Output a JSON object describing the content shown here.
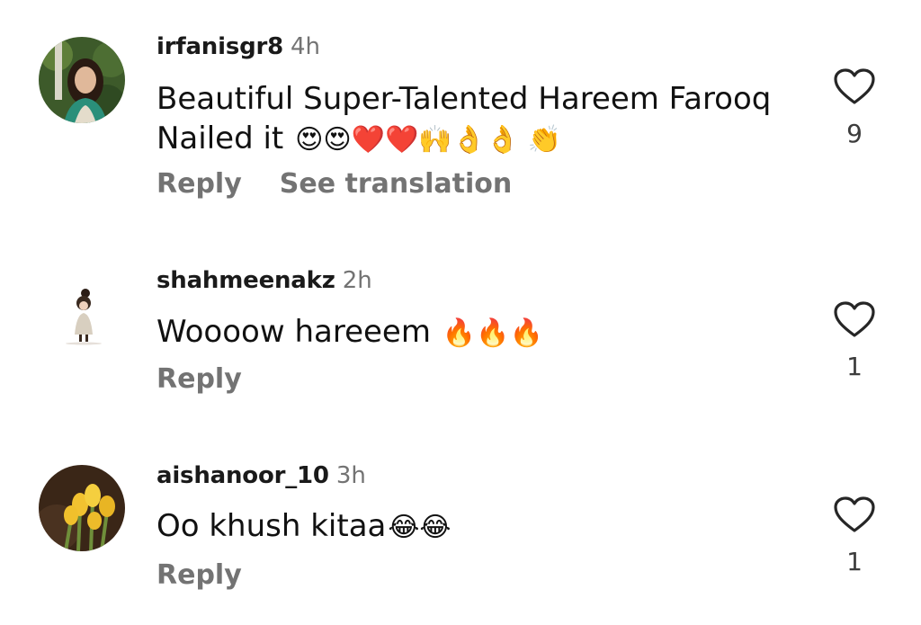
{
  "comments": [
    {
      "username": "irfanisgr8",
      "time": "4h",
      "line1": "Beautiful Super-Talented Hareem Farooq",
      "line2": "Nailed it",
      "emojis": "😍😍❤️❤️🙌👌👌 👏",
      "reply_label": "Reply",
      "translate_label": "See translation",
      "likes": "9",
      "avatar": "woman-portrait"
    },
    {
      "username": "shahmeenakz",
      "time": "2h",
      "line1": "Woooow hareeem",
      "emojis": "🔥🔥🔥",
      "reply_label": "Reply",
      "likes": "1",
      "avatar": "girl-cartoon"
    },
    {
      "username": "aishanoor_10",
      "time": "3h",
      "line1": "Oo khush kitaa",
      "emojis": "😂😂",
      "reply_label": "Reply",
      "likes": "1",
      "avatar": "yellow-tulips"
    }
  ],
  "icons": {
    "like": "heart-outline-icon"
  },
  "colors": {
    "text": "#111111",
    "secondary": "#737373",
    "background": "#ffffff"
  }
}
